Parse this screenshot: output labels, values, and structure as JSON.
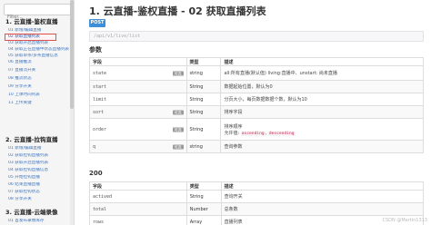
{
  "sidebar": {
    "filter_placeholder": "Filter...",
    "groups": [
      {
        "title": "1. 云直播-鉴权直播",
        "items": [
          {
            "label": "01 新增/编辑直播"
          },
          {
            "label": "02 获取直播列表",
            "active": true
          },
          {
            "label": "03 获取开启直播列表"
          },
          {
            "label": "04 获取正在直播中状态直播列表"
          },
          {
            "label": "05 获取单条/多条直播信息"
          },
          {
            "label": "06 直播推流"
          },
          {
            "label": "07 直播流开关"
          },
          {
            "label": "08 推流状态"
          },
          {
            "label": "09 分享开关"
          },
          {
            "label": "10 上课时间列表"
          },
          {
            "label": "11 上传关键"
          }
        ]
      },
      {
        "title": "2. 云直播-拉钩直播",
        "items": [
          {
            "label": "01 新增/编辑直播"
          },
          {
            "label": "02 获取拉钩直播列表"
          },
          {
            "label": "03 获取开启直播列表"
          },
          {
            "label": "04 获取拉钩直播信息"
          },
          {
            "label": "05 开始拉钩直播"
          },
          {
            "label": "06 结束直播直播"
          },
          {
            "label": "07 获取拉钩状态"
          },
          {
            "label": "08 分享开关"
          }
        ]
      },
      {
        "title": "3. 云直播-云端录像",
        "items": [
          {
            "label": "01 首发布录像库存"
          }
        ]
      }
    ]
  },
  "main": {
    "title": "1. 云直播-鉴权直播 - 02 获取直播列表",
    "method": "POST",
    "url_placeholder": "/api/v1/live/list",
    "params_title": "参数",
    "params_headers": [
      "字段",
      "类型",
      "描述"
    ],
    "optional_label": "可选",
    "params_rows": [
      {
        "field": "state",
        "optional": true,
        "type": "string",
        "desc": "all:所有直播(默认值) living:直播中、unstart: 尚未直播"
      },
      {
        "field": "start",
        "optional": false,
        "type": "String",
        "desc": "数据起始位置，默认为0"
      },
      {
        "field": "limit",
        "optional": false,
        "type": "String",
        "desc": "分页大小，每页数据数据个数，默认为10"
      },
      {
        "field": "sort",
        "optional": true,
        "type": "String",
        "desc": "排序字段"
      },
      {
        "field": "order",
        "optional": true,
        "type": "String",
        "desc_lines": [
          "排序顺序",
          "允许值: "
        ],
        "codes": [
          "ascending",
          "descending"
        ]
      },
      {
        "field": "q",
        "optional": true,
        "type": "string",
        "desc": "查询参数"
      }
    ],
    "response_title": "200",
    "response_headers": [
      "字段",
      "类型",
      "描述"
    ],
    "response_rows": [
      {
        "field": "actived",
        "type": "String",
        "desc": "查询开关"
      },
      {
        "field": "total",
        "type": "Number",
        "desc": "总条数"
      },
      {
        "field": "rows",
        "type": "Array",
        "desc": "直播列表"
      }
    ]
  },
  "watermark": "CSDN @Martin1313"
}
